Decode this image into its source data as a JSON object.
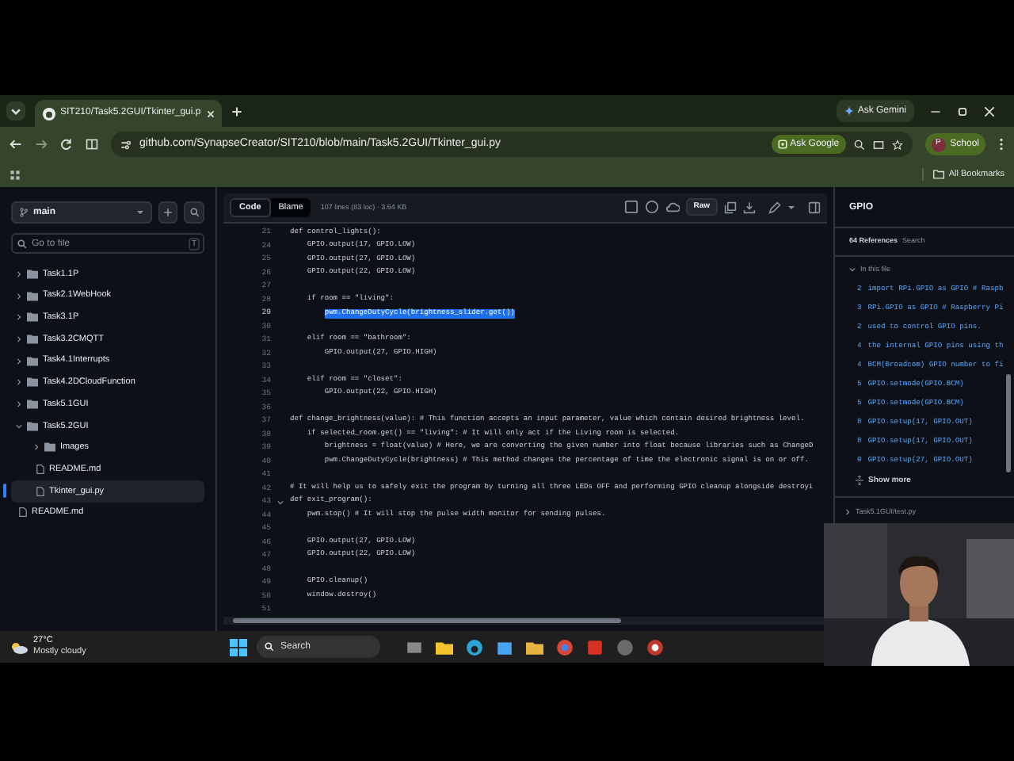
{
  "browser": {
    "tab": {
      "title": "SIT210/Task5.2GUI/Tkinter_gui.p"
    },
    "ask_gemini": "Ask Gemini",
    "url": "github.com/SynapseCreator/SIT210/blob/main/Task5.2GUI/Tkinter_gui.py",
    "ask_google": "Ask Google",
    "profile": {
      "initial": "P",
      "name": "School"
    },
    "bookmarks": "All Bookmarks"
  },
  "sidebar": {
    "branch": "main",
    "search_placeholder": "Go to file",
    "shortcut": "T",
    "tree": [
      {
        "kind": "folder",
        "name": "Task1.1P",
        "expanded": false,
        "selected": false
      },
      {
        "kind": "folder",
        "name": "Task2.1WebHook",
        "expanded": false,
        "selected": false
      },
      {
        "kind": "folder",
        "name": "Task3.1P",
        "expanded": false,
        "selected": false
      },
      {
        "kind": "folder",
        "name": "Task3.2CMQTT",
        "expanded": false,
        "selected": false
      },
      {
        "kind": "folder",
        "name": "Task4.1Interrupts",
        "expanded": false,
        "selected": false
      },
      {
        "kind": "folder",
        "name": "Task4.2DCloudFunction",
        "expanded": false,
        "selected": false
      },
      {
        "kind": "folder",
        "name": "Task5.1GUI",
        "expanded": false,
        "selected": false
      },
      {
        "kind": "folder",
        "name": "Task5.2GUI",
        "expanded": true,
        "selected": false,
        "children": [
          {
            "kind": "folder",
            "name": "Images",
            "expanded": false,
            "selected": false
          },
          {
            "kind": "file",
            "name": "README.md",
            "selected": false
          },
          {
            "kind": "file",
            "name": "Tkinter_gui.py",
            "selected": true
          }
        ]
      },
      {
        "kind": "file",
        "name": "README.md",
        "selected": false
      }
    ]
  },
  "file_header": {
    "tabs": [
      {
        "label": "Code",
        "selected": true
      },
      {
        "label": "Blame",
        "selected": false
      }
    ],
    "info": "107 lines (83 loc) · 3.64 KB",
    "raw": "Raw"
  },
  "code": {
    "lines": [
      {
        "number": "21",
        "text": "def control_lights():",
        "selected": false,
        "foldable": false
      },
      {
        "number": "24",
        "text": "    GPIO.output(17, GPIO.LOW)",
        "selected": false,
        "foldable": false
      },
      {
        "number": "25",
        "text": "    GPIO.output(27, GPIO.LOW)",
        "selected": false,
        "foldable": false
      },
      {
        "number": "26",
        "text": "    GPIO.output(22, GPIO.LOW)",
        "selected": false,
        "foldable": false
      },
      {
        "number": "27",
        "selected": false,
        "foldable": false
      },
      {
        "number": "28",
        "text": "    if room == \"living\":",
        "selected": false,
        "foldable": false
      },
      {
        "number": "29",
        "text": "        pwm.ChangeDutyCycle(brightness_slider.get())",
        "selected": true,
        "foldable": false
      },
      {
        "number": "30",
        "selected": false,
        "foldable": false
      },
      {
        "number": "31",
        "text": "    elif room == \"bathroom\":",
        "selected": false,
        "foldable": false
      },
      {
        "number": "32",
        "text": "        GPIO.output(27, GPIO.HIGH)",
        "selected": false,
        "foldable": false
      },
      {
        "number": "33",
        "selected": false,
        "foldable": false
      },
      {
        "number": "34",
        "text": "    elif room == \"closet\":",
        "selected": false,
        "foldable": false
      },
      {
        "number": "35",
        "text": "        GPIO.output(22, GPIO.HIGH)",
        "selected": false,
        "foldable": false
      },
      {
        "number": "36",
        "selected": false,
        "foldable": false
      },
      {
        "number": "37",
        "text": "def change_brightness(value): # This function accepts an input parameter, value which contain desired brightness level.",
        "selected": false,
        "foldable": false
      },
      {
        "number": "38",
        "text": "    if selected_room.get() == \"living\": # It will only act if the Living room is selected.",
        "selected": false,
        "foldable": false
      },
      {
        "number": "39",
        "text": "        brightness = float(value) # Here, we are converting the given number into float because libraries such as ChangeD",
        "selected": false,
        "foldable": false
      },
      {
        "number": "40",
        "text": "        pwm.ChangeDutyCycle(brightness) # This method changes the percentage of time the electronic signal is on or off.",
        "selected": false,
        "foldable": false
      },
      {
        "number": "41",
        "selected": false,
        "foldable": false
      },
      {
        "number": "42",
        "text": "# It will help us to safely exit the program by turning all three LEDs OFF and performing GPIO cleanup alongside destroyi",
        "selected": false,
        "foldable": false
      },
      {
        "number": "43",
        "text": "def exit_program():",
        "selected": false,
        "foldable": true
      },
      {
        "number": "44",
        "text": "    pwm.stop() # It will stop the pulse width monitor for sending pulses.",
        "selected": false,
        "foldable": false
      },
      {
        "number": "45",
        "selected": false,
        "foldable": false
      },
      {
        "number": "46",
        "text": "    GPIO.output(27, GPIO.LOW)",
        "selected": false,
        "foldable": false
      },
      {
        "number": "47",
        "text": "    GPIO.output(22, GPIO.LOW)",
        "selected": false,
        "foldable": false
      },
      {
        "number": "48",
        "selected": false,
        "foldable": false
      },
      {
        "number": "49",
        "text": "    GPIO.cleanup()",
        "selected": false,
        "foldable": false
      },
      {
        "number": "50",
        "text": "    window.destroy()",
        "selected": false,
        "foldable": false
      },
      {
        "number": "51",
        "selected": false,
        "foldable": false
      }
    ]
  },
  "references": {
    "symbol": "GPIO",
    "count": "64 References",
    "search": "Search",
    "group": {
      "label": "In this file",
      "expanded": true
    },
    "items": [
      {
        "line": "2",
        "text": "import RPi.GPIO as GPIO # Raspb"
      },
      {
        "line": "3",
        "text": "RPi.GPIO as GPIO # Raspberry Pi"
      },
      {
        "line": "2",
        "text": "used to control GPIO pins."
      },
      {
        "line": "4",
        "text": "the internal GPIO pins using th"
      },
      {
        "line": "4",
        "text": "BCM(Broadcom) GPIO number to fi"
      },
      {
        "line": "5",
        "text": "GPIO.setmode(GPIO.BCM)"
      },
      {
        "line": "5",
        "text": "GPIO.setmode(GPIO.BCM)"
      },
      {
        "line": "8",
        "text": "GPIO.setup(17, GPIO.OUT)"
      },
      {
        "line": "8",
        "text": "GPIO.setup(17, GPIO.OUT)"
      },
      {
        "line": "9",
        "text": "GPIO.setup(27, GPIO.OUT)"
      }
    ],
    "show_more": "Show more",
    "other_file": "Task5.1GUI/test.py"
  },
  "taskbar": {
    "temperature": "27°C",
    "weather": "Mostly cloudy",
    "search": "Search"
  }
}
